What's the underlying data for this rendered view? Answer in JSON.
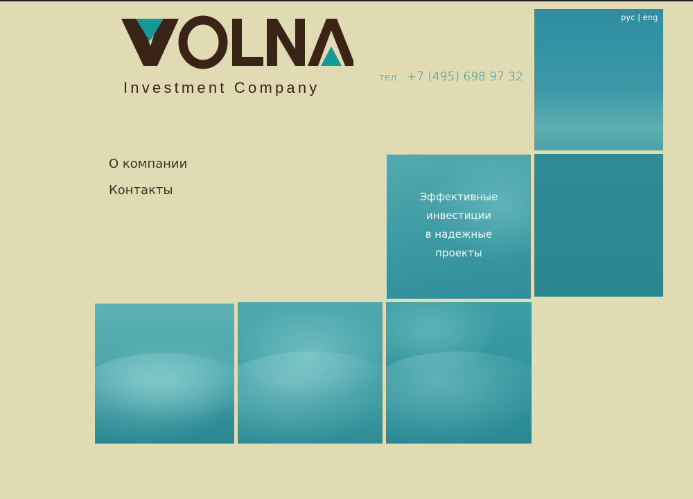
{
  "brand": {
    "logo_text": "VOLNA",
    "tagline": "Investment Company",
    "colors": {
      "dark": "#3a2418",
      "accent": "#139a96",
      "background": "#e0dbb3"
    }
  },
  "contact": {
    "phone_prefix": "тел.:",
    "phone": "+7 (495) 698 97 32"
  },
  "language": {
    "ru": "рус",
    "separator": "|",
    "en": "eng"
  },
  "nav": {
    "items": [
      {
        "label": "О компании"
      },
      {
        "label": "Контакты"
      }
    ]
  },
  "slogan": {
    "lines": [
      "Эффективные",
      "инвестиции",
      "в надежные",
      "проекты"
    ]
  }
}
